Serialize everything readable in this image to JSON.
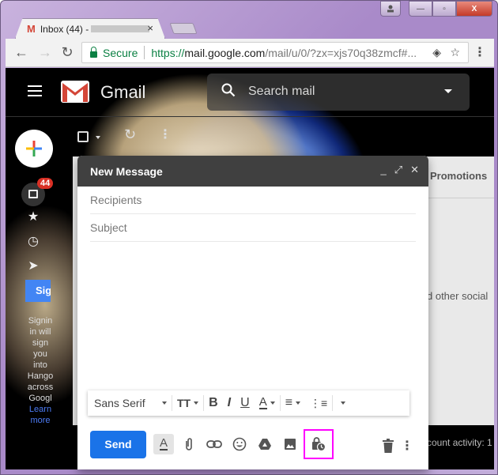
{
  "browser": {
    "tab_title": "Inbox (44) -",
    "tab_close": "×",
    "secure_label": "Secure",
    "url_scheme": "https://",
    "url_host": "mail.google.com",
    "url_rest": "/mail/u/0/?zx=xjs70q38zmcf#...",
    "nav": {
      "back": "←",
      "forward": "→",
      "reload": "↻"
    },
    "window_buttons": {
      "minimize": "—",
      "maximize": "▫",
      "close": "X"
    }
  },
  "gmail": {
    "brand": "Gmail",
    "search_placeholder": "Search mail",
    "unread_badge": "44",
    "signin_label": "Sig",
    "hangouts_text": [
      "Signin",
      "in will",
      "sign",
      "you",
      "into",
      "Hango",
      "across",
      "Googl"
    ],
    "learn_more": [
      "Learn",
      "more"
    ],
    "promotions_tab": "Promotions",
    "snippet_text": "d other social",
    "account_activity": "count activity: 1"
  },
  "compose": {
    "title": "New Message",
    "header_buttons": {
      "minimize": "_",
      "fullscreen": "⤢",
      "close": "✕"
    },
    "recipients_placeholder": "Recipients",
    "subject_placeholder": "Subject",
    "formatting": {
      "font": "Sans Serif",
      "size_icon": "TT",
      "bold": "B",
      "italic": "I",
      "underline": "U",
      "text_color": "A",
      "align": "≡",
      "numbered_list": "⋮≡"
    },
    "send_label": "Send",
    "bottom_icons": {
      "formatting_toggle": "A",
      "attach": "📎",
      "link": "⊖",
      "emoji": "☺",
      "drive": "▲",
      "photo": "▣",
      "confidential": "🔒",
      "trash": "🗑",
      "more": "⋮"
    }
  },
  "colors": {
    "send_blue": "#1a73e8",
    "highlight_magenta": "#ff00ff",
    "badge_red": "#d93025",
    "header_dark": "#404040"
  }
}
